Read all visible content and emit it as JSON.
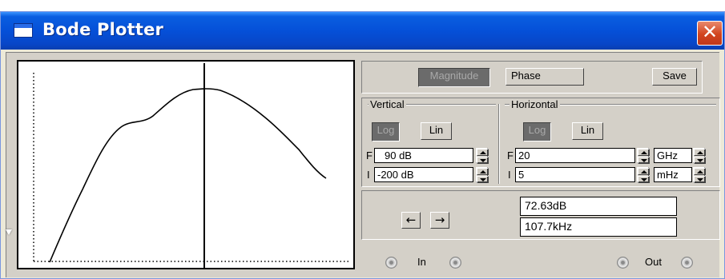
{
  "window": {
    "title": "Bode Plotter",
    "close_glyph": "✕",
    "title_bar_color": "#0550d8"
  },
  "mode_bar": {
    "magnitude_label": "Magnitude",
    "phase_label": "Phase",
    "save_label": "Save",
    "selected": "Magnitude"
  },
  "vertical": {
    "group_label": "Vertical",
    "log_label": "Log",
    "lin_label": "Lin",
    "selected_scale": "Log",
    "final_letter": "F",
    "final_value": "90 dB",
    "initial_letter": "I",
    "initial_value": "-200 dB"
  },
  "horizontal": {
    "group_label": "Horizontal",
    "log_label": "Log",
    "lin_label": "Lin",
    "selected_scale": "Log",
    "final_letter": "F",
    "final_value": "20",
    "final_unit": "GHz",
    "initial_letter": "I",
    "initial_value": "5",
    "initial_unit": "mHz"
  },
  "cursor": {
    "left_arrow": "←",
    "right_arrow": "→",
    "magnitude_readout": "72.63dB",
    "frequency_readout": "107.7kHz"
  },
  "terminals": {
    "in_label": "In",
    "out_label": "Out"
  }
}
